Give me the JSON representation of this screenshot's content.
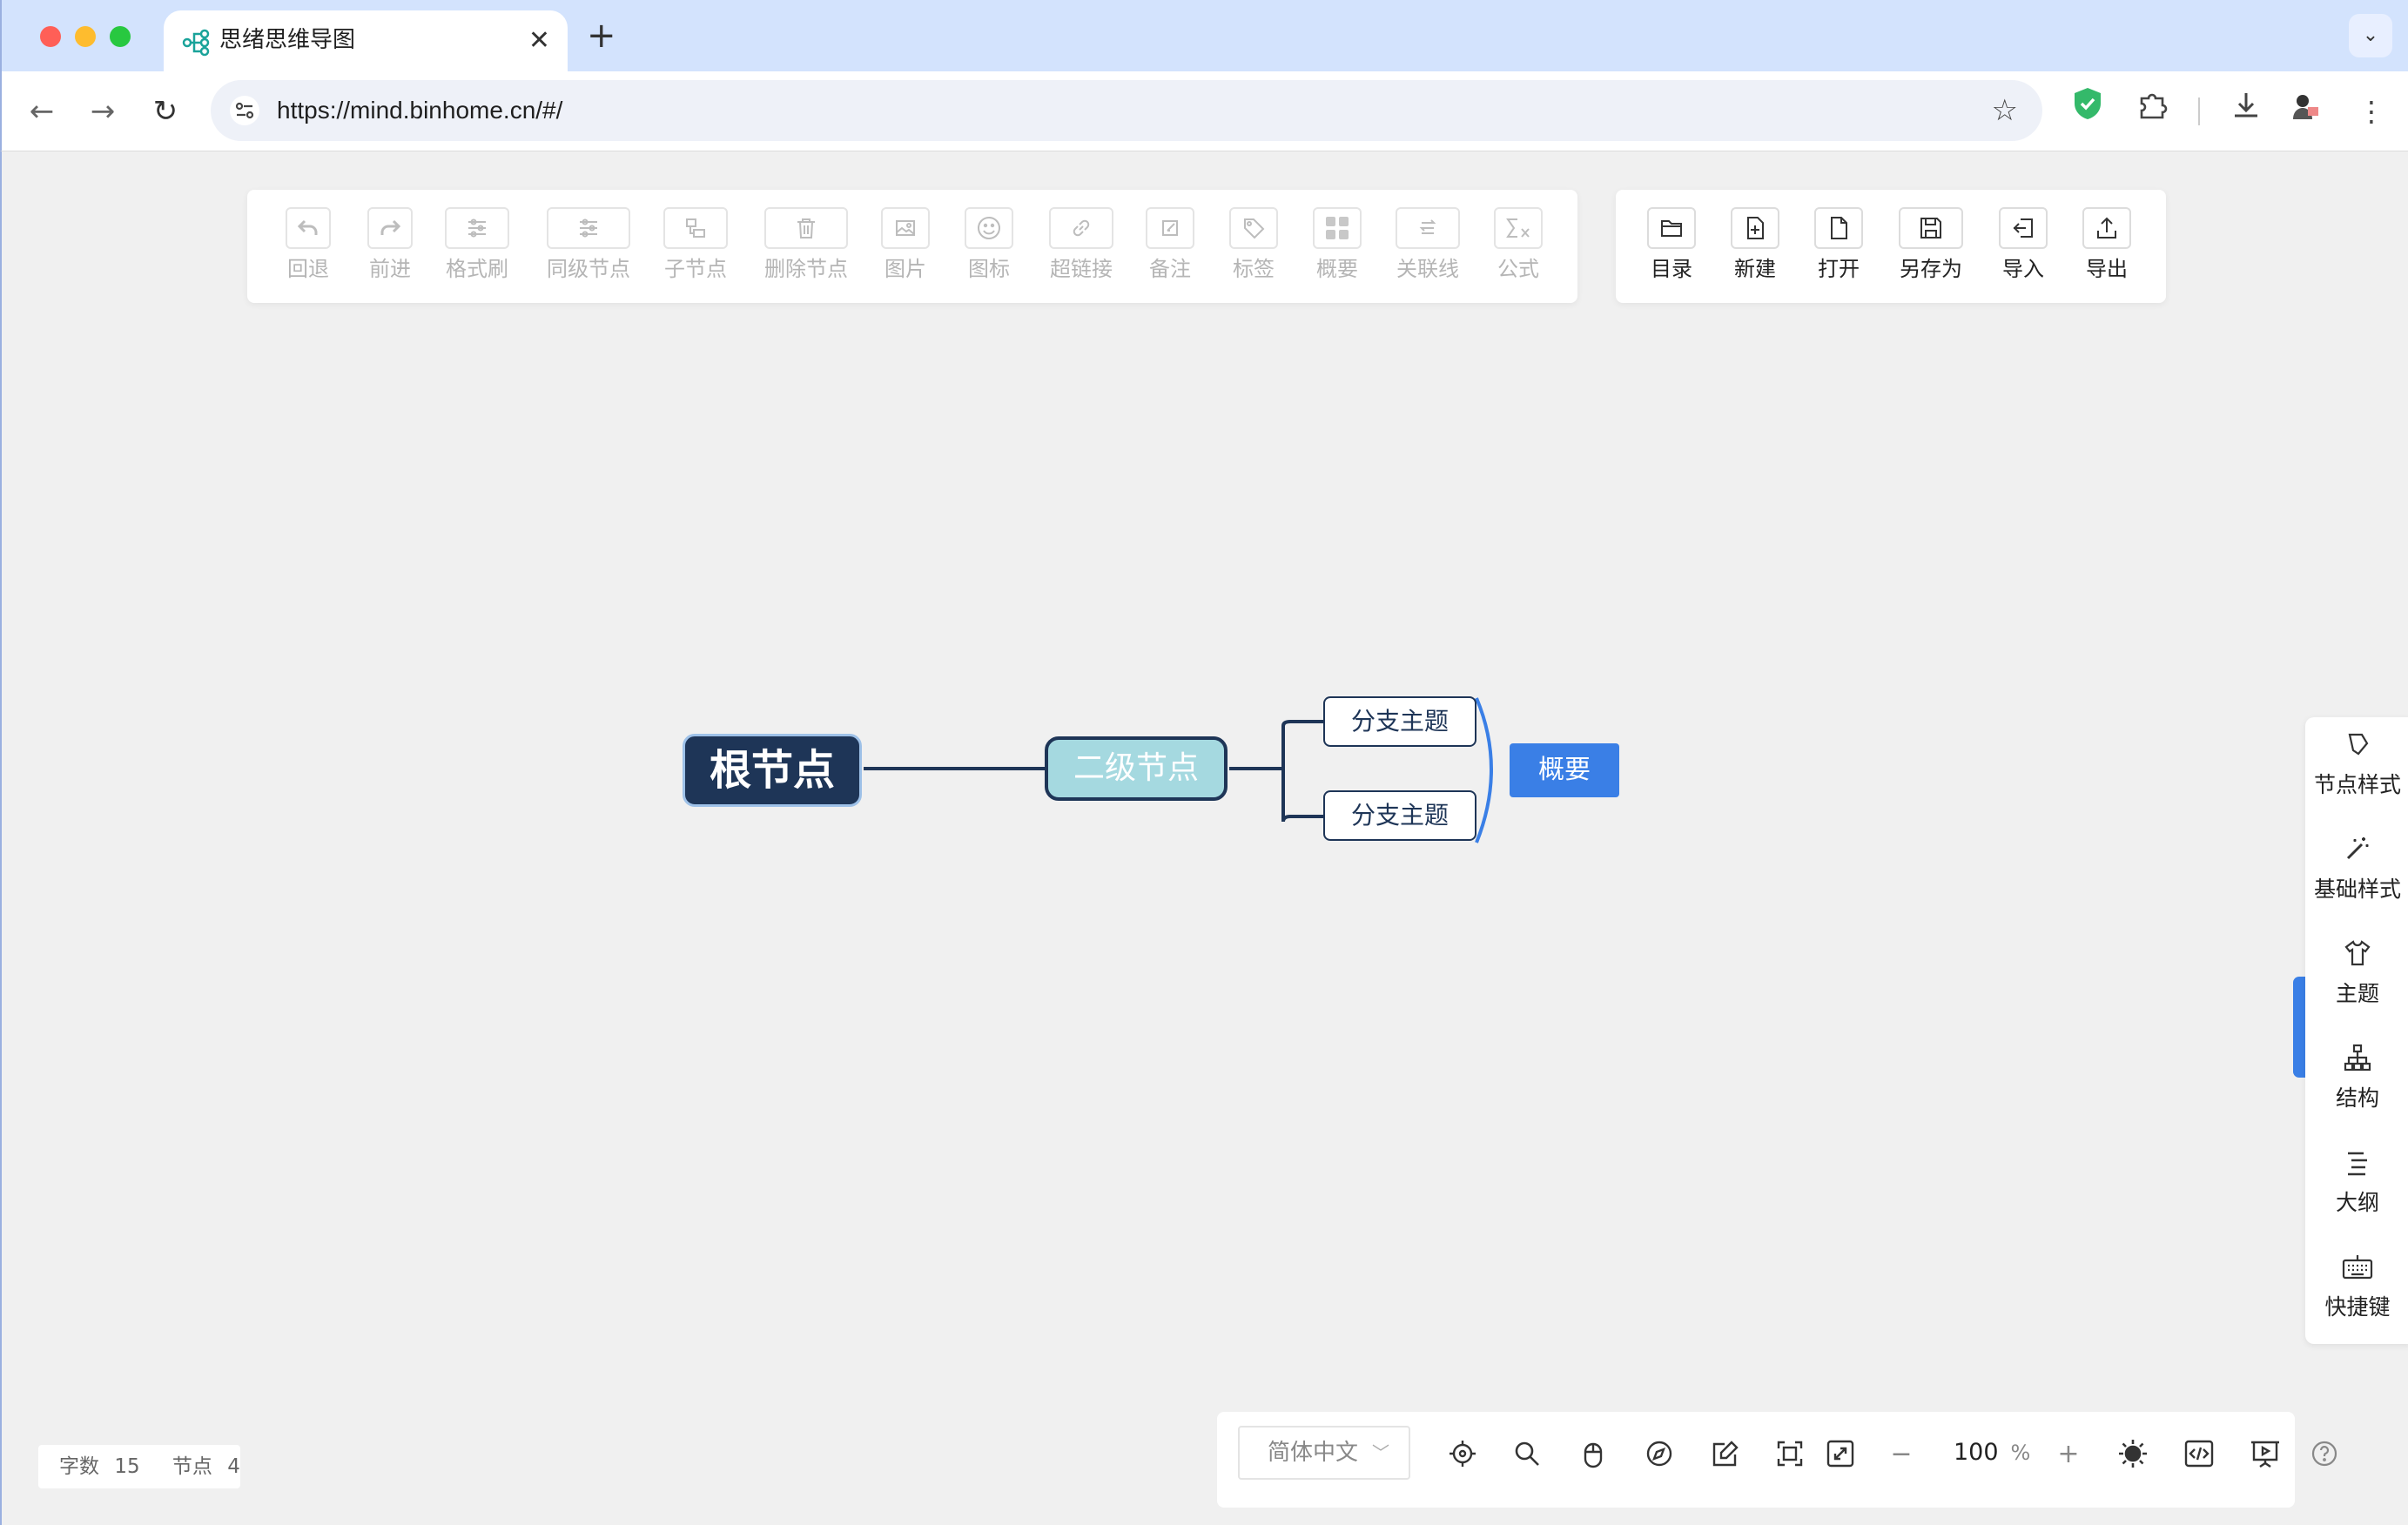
{
  "browser": {
    "tab_title": "思绪思维导图",
    "tab_close": "✕",
    "new_tab": "+",
    "tab_menu": "⌄",
    "url": "https://mind.binhome.cn/#/"
  },
  "toolbar_left": [
    {
      "id": "undo",
      "label": "回退",
      "icon": "undo-icon"
    },
    {
      "id": "redo",
      "label": "前进",
      "icon": "redo-icon"
    },
    {
      "id": "format-painter",
      "label": "格式刷",
      "icon": "sliders-icon"
    },
    {
      "id": "sibling-node",
      "label": "同级节点",
      "icon": "sliders-icon"
    },
    {
      "id": "child-node",
      "label": "子节点",
      "icon": "child-node-icon"
    },
    {
      "id": "delete-node",
      "label": "删除节点",
      "icon": "trash-icon"
    },
    {
      "id": "image",
      "label": "图片",
      "icon": "image-icon"
    },
    {
      "id": "icon",
      "label": "图标",
      "icon": "smiley-icon"
    },
    {
      "id": "hyperlink",
      "label": "超链接",
      "icon": "link-icon"
    },
    {
      "id": "note",
      "label": "备注",
      "icon": "note-icon"
    },
    {
      "id": "tag",
      "label": "标签",
      "icon": "tag-icon"
    },
    {
      "id": "summary",
      "label": "概要",
      "icon": "grid-icon"
    },
    {
      "id": "association",
      "label": "关联线",
      "icon": "association-icon"
    },
    {
      "id": "formula",
      "label": "公式",
      "icon": "sigma-icon"
    }
  ],
  "toolbar_right": [
    {
      "id": "directory",
      "label": "目录",
      "icon": "folder-icon"
    },
    {
      "id": "new",
      "label": "新建",
      "icon": "new-file-icon"
    },
    {
      "id": "open",
      "label": "打开",
      "icon": "file-icon"
    },
    {
      "id": "save-as",
      "label": "另存为",
      "icon": "save-icon"
    },
    {
      "id": "import",
      "label": "导入",
      "icon": "import-icon"
    },
    {
      "id": "export",
      "label": "导出",
      "icon": "export-icon"
    }
  ],
  "mindmap": {
    "root": "根节点",
    "second_level": "二级节点",
    "branches": [
      "分支主题",
      "分支主题"
    ],
    "summary": "概要",
    "colors": {
      "root_bg": "#1e3557",
      "second_bg": "#a5d9e0",
      "summary_bg": "#3a7fe6"
    }
  },
  "right_sidebar": [
    {
      "id": "node-style",
      "label": "节点样式",
      "icon": "node-style-icon"
    },
    {
      "id": "base-style",
      "label": "基础样式",
      "icon": "magic-wand-icon"
    },
    {
      "id": "theme",
      "label": "主题",
      "icon": "shirt-icon"
    },
    {
      "id": "structure",
      "label": "结构",
      "icon": "structure-icon"
    },
    {
      "id": "outline",
      "label": "大纲",
      "icon": "outline-icon"
    },
    {
      "id": "shortcuts",
      "label": "快捷键",
      "icon": "keyboard-icon"
    }
  ],
  "counter": {
    "word_label": "字数",
    "word_count": "15",
    "node_label": "节点",
    "node_count": "4"
  },
  "bottom_bar": {
    "language": "简体中文",
    "zoom": "100",
    "zoom_unit": "%",
    "zoom_out": "−",
    "zoom_in": "+"
  }
}
